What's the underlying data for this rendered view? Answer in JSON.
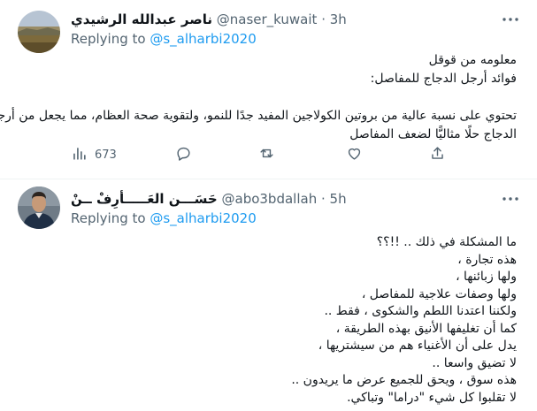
{
  "tweets": [
    {
      "display_name": "ناصر عبدالله الرشيدي",
      "handle": "@naser_kuwait",
      "separator": "·",
      "time": "3h",
      "replying_prefix": "Replying to",
      "replying_to": "@s_alharbi2020",
      "lines": [
        "معلومه من قوقل",
        "فوائد أرجل الدجاج للمفاصل:",
        "",
        "تحتوي على نسبة عالية من بروتين الكولاجين المفيد جدًا للنمو، ولتقوية صحة العظام، مما يجعل من أرجل",
        "الدجاج حلًا مثاليًّا لضعف المفاصل"
      ],
      "views": "673",
      "icons": {
        "views": "bar-chart-icon",
        "reply": "reply-bubble-icon",
        "retweet": "retweet-icon",
        "like": "heart-icon",
        "share": "share-icon",
        "more": "more-dots-icon"
      }
    },
    {
      "display_name": "حَسَـــن العَـــــأرِفْ ــنْ",
      "handle": "@abo3bdallah",
      "separator": "·",
      "time": "5h",
      "replying_prefix": "Replying to",
      "replying_to": "@s_alharbi2020",
      "lines": [
        "ما المشكلة في ذلك .. !!؟؟",
        "هذه تجارة ،",
        "ولها زبائنها ،",
        "ولها وصفات علاجية للمفاصل ،",
        "ولكننا اعتدنا اللطم والشكوى ، فقط ..",
        "كما أن تغليفها الأنيق بهذه الطريقة ،",
        "يدل على أن الأغنياء هم من سيشتريها ،",
        "لا تضيق واسعا ..",
        "هذه سوق ، ويحق للجميع عرض ما يريدون ..",
        "لا تقلبوا كل شيء \"دراما\" وتباكي."
      ],
      "icons": {
        "more": "more-dots-icon"
      }
    }
  ],
  "colors": {
    "text": "#0f1419",
    "secondary": "#536471",
    "link": "#1d9bf0",
    "divider": "#eff3f4"
  }
}
